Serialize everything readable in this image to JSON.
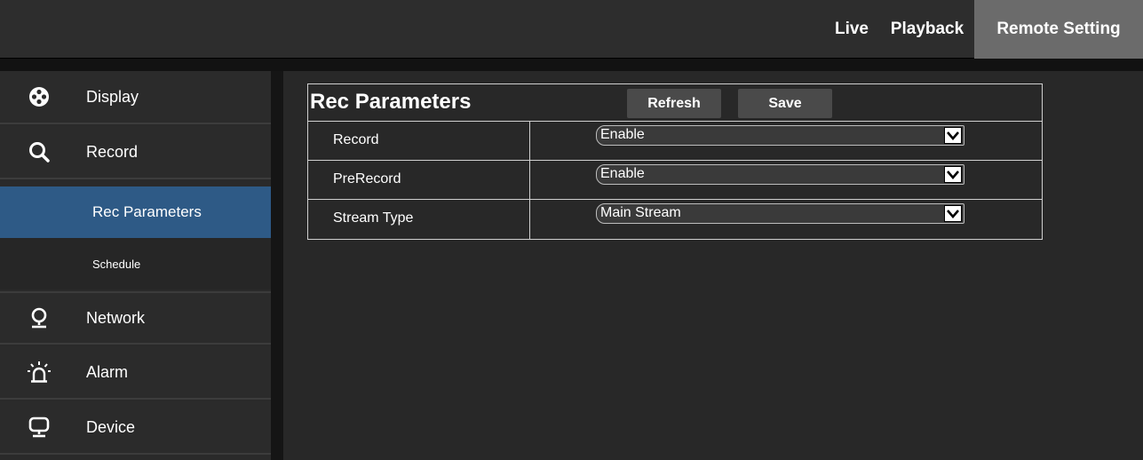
{
  "topnav": {
    "live": "Live",
    "playback": "Playback",
    "remote_setting": "Remote Setting"
  },
  "sidebar": {
    "items": [
      {
        "label": "Display",
        "icon": "display-icon"
      },
      {
        "label": "Record",
        "icon": "search-icon"
      },
      {
        "label": "Network",
        "icon": "network-icon"
      },
      {
        "label": "Alarm",
        "icon": "alarm-icon"
      },
      {
        "label": "Device",
        "icon": "device-icon"
      }
    ],
    "sub_items": [
      {
        "label": "Rec Parameters",
        "active": true
      },
      {
        "label": "Schedule",
        "active": false
      }
    ]
  },
  "panel": {
    "title": "Rec Parameters",
    "refresh_label": "Refresh",
    "save_label": "Save",
    "rows": [
      {
        "label": "Record",
        "value": "Enable"
      },
      {
        "label": "PreRecord",
        "value": "Enable"
      },
      {
        "label": "Stream Type",
        "value": "Main Stream"
      }
    ]
  },
  "colors": {
    "active_sub": "#2e5a86",
    "active_tab": "#6b6b6b",
    "background": "#282828"
  }
}
